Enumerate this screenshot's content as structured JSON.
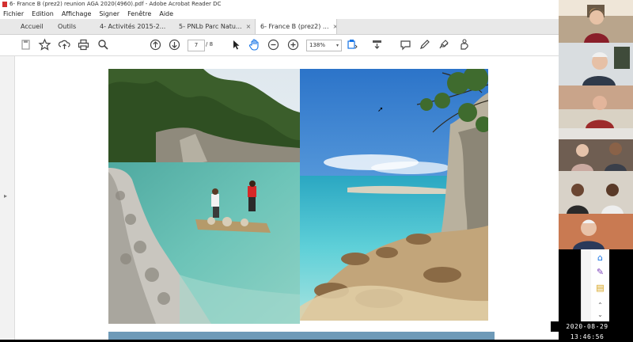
{
  "window": {
    "title": "6- France B (prez2) reunion AGA 2020(4960).pdf - Adobe Acrobat Reader DC"
  },
  "menu": [
    "Fichier",
    "Edition",
    "Affichage",
    "Signer",
    "Fenêtre",
    "Aide"
  ],
  "tabs": [
    {
      "label": "Accueil"
    },
    {
      "label": "Outils"
    },
    {
      "label": "4- Activités 2015-2...",
      "close": "×"
    },
    {
      "label": "5- PNLb Parc Natu...",
      "close": "×"
    },
    {
      "label": "6- France B (prez2) ...",
      "close": "×"
    }
  ],
  "toolbar": {
    "current_page": "7",
    "page_total": "/ 8",
    "zoom": "138%",
    "zoom_dropdown": "▾"
  },
  "icons": {
    "save": "save-icon",
    "star": "star-icon",
    "upload": "upload-icon",
    "print": "print-icon",
    "search": "search-icon"
  },
  "timestamp": "2020-08-29  13:46:56",
  "colors": {
    "accent": "#1473e6",
    "tab_bg": "#e8e8e8",
    "pdf_red": "#d32f2f"
  }
}
